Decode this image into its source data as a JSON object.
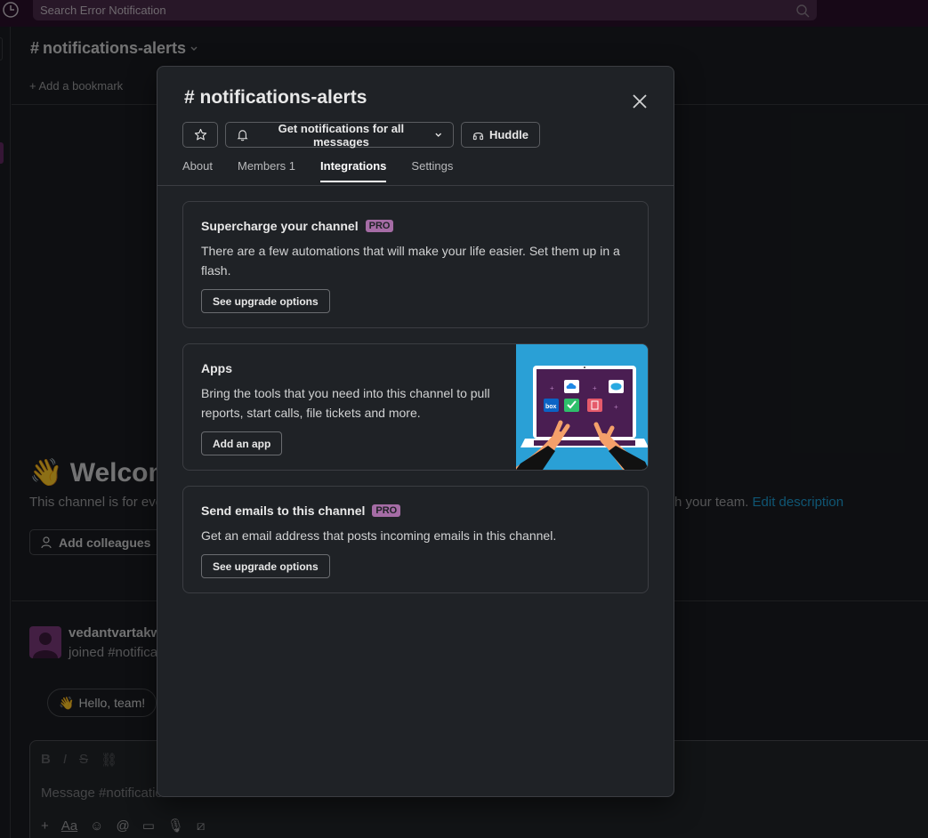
{
  "topbar": {
    "search_placeholder": "Search Error Notification"
  },
  "background": {
    "channel_title": "notifications-alerts",
    "bookmark": "Add a bookmark",
    "welcome": "Welcom",
    "desc_left": "This channel is for eve",
    "desc_right": "h your team.",
    "edit_description": "Edit description",
    "add_colleagues": "Add colleagues",
    "user": "vedantvartakw",
    "joined": "joined #notifica",
    "hello": "Hello, team!",
    "message_placeholder": "Message #notifications-alerts"
  },
  "modal": {
    "title": "notifications-alerts",
    "notify_label": "Get notifications for all messages",
    "huddle_label": "Huddle",
    "tabs": [
      {
        "label": "About"
      },
      {
        "label": "Members 1"
      },
      {
        "label": "Integrations"
      },
      {
        "label": "Settings"
      }
    ],
    "active_tab": "Integrations",
    "cards": [
      {
        "title": "Supercharge your channel",
        "badge": "PRO",
        "text": "There are a few automations that will make your life easier. Set them up in a flash.",
        "button": "See upgrade options"
      },
      {
        "title": "Apps",
        "text": "Bring the tools that you need into this channel to pull reports, start calls, file tickets and more.",
        "button": "Add an app"
      },
      {
        "title": "Send emails to this channel",
        "badge": "PRO",
        "text": "Get an email address that posts incoming emails in this channel.",
        "button": "See upgrade options"
      }
    ]
  },
  "colors": {
    "accent_pro": "#a56ca5",
    "illustration_bg": "#2aa0d6",
    "link": "#1d9bd1"
  }
}
